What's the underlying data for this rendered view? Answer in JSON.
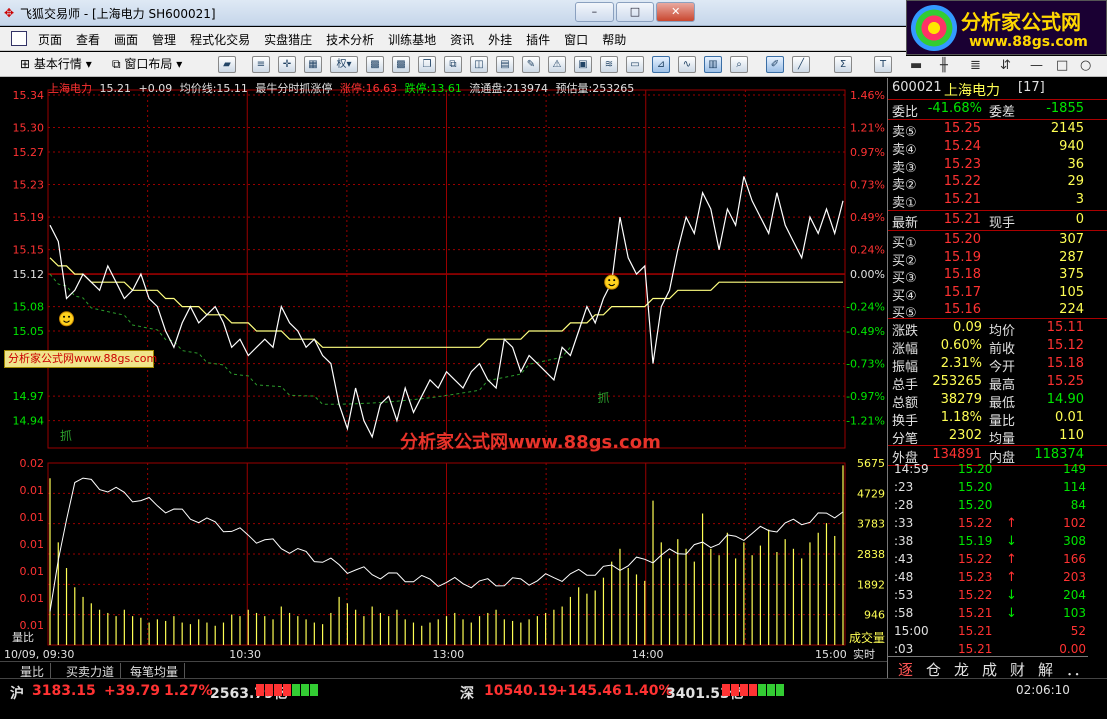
{
  "window": {
    "title": "飞狐交易师 - [上海电力 SH600021]"
  },
  "logo": {
    "name": "分析家公式网",
    "url": "www.88gs.com"
  },
  "menu": [
    "页面",
    "查看",
    "画面",
    "管理",
    "程式化交易",
    "实盘猎庄",
    "技术分析",
    "训练基地",
    "资讯",
    "外挂",
    "插件",
    "窗口",
    "帮助"
  ],
  "toolbar": {
    "basic_label": "基本行情",
    "layout_label": "窗口布局",
    "quan_label": "权"
  },
  "chart_info": {
    "name": "上海电力",
    "price": "15.21",
    "change": "+0.09",
    "avg_label": "均价线:15.11",
    "indicator": "最牛分时抓涨停",
    "zhangting": "涨停:16.63",
    "dieting": "跌停:13.61",
    "float_cap": "流通盘:213974",
    "est_vol": "预估量:253265"
  },
  "watermark": {
    "tag": "分析家公式网www.88gs.com",
    "center": "分析家公式网www.88gs.com"
  },
  "signals": {
    "buy_text": "抓"
  },
  "colors": {
    "up": "#ff3232",
    "down": "#00e600",
    "price_line": "#ffffff",
    "avg_line": "#ffff80",
    "grid": "#9a0000",
    "volume": "#ffff54"
  },
  "chart_data": {
    "type": "line",
    "price_axis": {
      "ticks": [
        "15.34",
        "15.30",
        "15.27",
        "15.23",
        "15.19",
        "15.15",
        "15.12",
        "15.08",
        "15.05",
        "15.01",
        "14.97",
        "14.94"
      ],
      "range": [
        14.91,
        15.34
      ],
      "prev_close": 15.12
    },
    "pct_axis": {
      "ticks": [
        "1.46%",
        "1.21%",
        "0.97%",
        "0.73%",
        "0.49%",
        "0.24%",
        "0.00%",
        "-0.24%",
        "-0.49%",
        "-0.73%",
        "-0.97%",
        "-1.21%"
      ]
    },
    "volume_axis": {
      "ticks": [
        "5675",
        "4729",
        "3783",
        "2838",
        "1892",
        "946"
      ],
      "max": 5675,
      "label": "成交量"
    },
    "indicator_axis": {
      "ticks": [
        "0.02",
        "0.01",
        "0.01",
        "0.01",
        "0.01",
        "0.01",
        "0.01"
      ],
      "label": "量比"
    },
    "time_axis": [
      "10/09, 09:30",
      "10:30",
      "13:00",
      "14:00",
      "15:00"
    ],
    "time_right_label": "实时",
    "price": [
      15.18,
      15.16,
      15.09,
      15.1,
      15.12,
      15.11,
      15.1,
      15.13,
      15.11,
      15.09,
      15.1,
      15.12,
      15.09,
      15.08,
      15.05,
      15.03,
      15.06,
      15.08,
      15.06,
      15.07,
      15.08,
      15.06,
      15.03,
      15.04,
      15.02,
      15.03,
      15.04,
      15.03,
      15.08,
      15.06,
      15.05,
      15.03,
      15.04,
      15.02,
      15.01,
      14.96,
      14.93,
      14.98,
      14.94,
      14.92,
      14.96,
      14.97,
      14.94,
      14.98,
      14.95,
      14.97,
      14.99,
      14.98,
      15.0,
      14.99,
      14.98,
      15.0,
      15.01,
      14.99,
      14.98,
      15.04,
      15.03,
      15.0,
      15.02,
      15.01,
      15.0,
      14.99,
      15.03,
      15.02,
      15.05,
      15.08,
      15.06,
      15.09,
      15.11,
      15.19,
      15.14,
      15.12,
      15.13,
      15.01,
      15.08,
      15.1,
      15.15,
      15.19,
      15.17,
      15.22,
      15.2,
      15.15,
      15.2,
      15.18,
      15.24,
      15.21,
      15.19,
      15.17,
      15.22,
      15.18,
      15.16,
      15.14,
      15.19,
      15.17,
      15.2,
      15.17,
      15.21
    ],
    "avg": [
      15.14,
      15.13,
      15.13,
      15.12,
      15.12,
      15.11,
      15.11,
      15.11,
      15.11,
      15.11,
      15.1,
      15.1,
      15.1,
      15.1,
      15.09,
      15.09,
      15.08,
      15.08,
      15.08,
      15.07,
      15.07,
      15.07,
      15.06,
      15.06,
      15.06,
      15.05,
      15.05,
      15.05,
      15.05,
      15.04,
      15.04,
      15.04,
      15.04,
      15.03,
      15.03,
      15.03,
      15.03,
      15.03,
      15.03,
      15.03,
      15.03,
      15.03,
      15.03,
      15.03,
      15.03,
      15.03,
      15.03,
      15.03,
      15.03,
      15.03,
      15.03,
      15.03,
      15.03,
      15.04,
      15.04,
      15.04,
      15.04,
      15.04,
      15.05,
      15.05,
      15.05,
      15.05,
      15.05,
      15.06,
      15.06,
      15.06,
      15.07,
      15.07,
      15.08,
      15.08,
      15.08,
      15.08,
      15.08,
      15.09,
      15.09,
      15.09,
      15.1,
      15.1,
      15.1,
      15.1,
      15.1,
      15.11,
      15.11,
      15.11,
      15.11,
      15.11,
      15.11,
      15.11,
      15.11,
      15.11,
      15.11,
      15.11,
      15.11,
      15.11,
      15.11,
      15.11,
      15.11
    ],
    "volume": [
      5200,
      3200,
      2400,
      1800,
      1500,
      1300,
      1100,
      1000,
      900,
      1100,
      900,
      850,
      700,
      800,
      750,
      900,
      700,
      650,
      800,
      700,
      600,
      700,
      950,
      900,
      1100,
      1000,
      900,
      800,
      1200,
      1000,
      900,
      800,
      700,
      650,
      1000,
      1500,
      1300,
      1100,
      900,
      1200,
      1000,
      900,
      1100,
      800,
      700,
      600,
      700,
      800,
      900,
      1000,
      800,
      700,
      900,
      1000,
      1100,
      800,
      750,
      700,
      800,
      900,
      1000,
      1100,
      1200,
      1500,
      1800,
      1600,
      1700,
      2100,
      2600,
      3000,
      2400,
      2200,
      2000,
      4500,
      3200,
      2700,
      3300,
      3000,
      2600,
      4100,
      3000,
      2800,
      3500,
      2700,
      3200,
      2800,
      3100,
      3600,
      2900,
      3300,
      3000,
      2700,
      3200,
      3500,
      3800,
      3400,
      5600
    ]
  },
  "quote_panel": {
    "code": "600021",
    "name": "上海电力",
    "badge": "[17]",
    "webi_label": "委比",
    "webi": "-41.68%",
    "weicha_label": "委差",
    "weicha": "-1855",
    "sells": [
      {
        "label": "卖⑤",
        "price": "15.25",
        "vol": "2145"
      },
      {
        "label": "卖④",
        "price": "15.24",
        "vol": "940"
      },
      {
        "label": "卖③",
        "price": "15.23",
        "vol": "36"
      },
      {
        "label": "卖②",
        "price": "15.22",
        "vol": "29"
      },
      {
        "label": "卖①",
        "price": "15.21",
        "vol": "3"
      }
    ],
    "latest_label": "最新",
    "latest": "15.21",
    "xianshou_label": "现手",
    "xianshou": "0",
    "buys": [
      {
        "label": "买①",
        "price": "15.20",
        "vol": "307"
      },
      {
        "label": "买②",
        "price": "15.19",
        "vol": "287"
      },
      {
        "label": "买③",
        "price": "15.18",
        "vol": "375"
      },
      {
        "label": "买④",
        "price": "15.17",
        "vol": "105"
      },
      {
        "label": "买⑤",
        "price": "15.16",
        "vol": "224"
      }
    ],
    "stats": [
      {
        "l1": "涨跌",
        "v1": "0.09",
        "l2": "均价",
        "v2": "15.11"
      },
      {
        "l1": "涨幅",
        "v1": "0.60%",
        "l2": "前收",
        "v2": "15.12"
      },
      {
        "l1": "振幅",
        "v1": "2.31%",
        "l2": "今开",
        "v2": "15.18"
      },
      {
        "l1": "总手",
        "v1": "253265",
        "l2": "最高",
        "v2": "15.25"
      },
      {
        "l1": "总额",
        "v1": "38279",
        "l2": "最低",
        "v2": "14.90"
      },
      {
        "l1": "换手",
        "v1": "1.18%",
        "l2": "量比",
        "v2": "0.01"
      },
      {
        "l1": "分笔",
        "v1": "2302",
        "l2": "均量",
        "v2": "110"
      }
    ],
    "waipan_label": "外盘",
    "waipan": "134891",
    "neipan_label": "内盘",
    "neipan": "118374",
    "ticks": [
      {
        "t": "14:59",
        "p": "15.20",
        "a": "",
        "v": "149"
      },
      {
        "t": ":23",
        "p": "15.20",
        "a": "",
        "v": "114"
      },
      {
        "t": ":28",
        "p": "15.20",
        "a": "",
        "v": "84"
      },
      {
        "t": ":33",
        "p": "15.22",
        "a": "↑",
        "v": "102"
      },
      {
        "t": ":38",
        "p": "15.19",
        "a": "↓",
        "v": "308"
      },
      {
        "t": ":43",
        "p": "15.22",
        "a": "↑",
        "v": "166"
      },
      {
        "t": ":48",
        "p": "15.23",
        "a": "↑",
        "v": "203"
      },
      {
        "t": ":53",
        "p": "15.22",
        "a": "↓",
        "v": "204"
      },
      {
        "t": ":58",
        "p": "15.21",
        "a": "↓",
        "v": "103"
      },
      {
        "t": "15:00",
        "p": "15.21",
        "a": "",
        "v": "52"
      },
      {
        "t": ":03",
        "p": "15.21",
        "a": "",
        "v": "0.00"
      }
    ],
    "tabs": [
      "逐",
      "仓",
      "龙",
      "成",
      "财",
      "解",
      "．．"
    ]
  },
  "bottom_tabs": [
    "量比",
    "买卖力道",
    "每笔均量"
  ],
  "status": {
    "sh_label": "沪",
    "sh_index": "3183.15",
    "sh_change": "+39.79",
    "sh_pct": "1.27%",
    "sh_amount": "2563.79亿",
    "sz_label": "深",
    "sz_index": "10540.19",
    "sz_change": "+145.46",
    "sz_pct": "1.40%",
    "sz_amount": "3401.53亿",
    "clock": "02:06:10"
  }
}
